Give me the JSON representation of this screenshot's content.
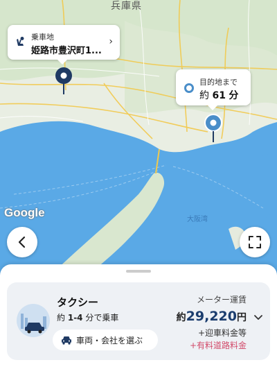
{
  "map": {
    "place_label": "兵庫県",
    "bay_label": "大阪湾",
    "provider_logo": "Google"
  },
  "pickup": {
    "title": "乗車地",
    "address": "姫路市豊沢町1...",
    "icon": "person-seat-icon"
  },
  "destination": {
    "title": "目的地まで",
    "time_prefix": "約",
    "time_value": "61",
    "time_unit": "分"
  },
  "controls": {
    "back_icon": "chevron-left-icon",
    "expand_icon": "fullscreen-icon"
  },
  "taxi": {
    "name": "タクシー",
    "eta_prefix": "約",
    "eta_value": "1-4",
    "eta_suffix": "分で乗車",
    "choose_label": "車両・会社を選ぶ"
  },
  "fare": {
    "label": "メーター運賃",
    "prefix": "約",
    "amount": "29,220",
    "unit": "円",
    "extra1": "+迎車料金等",
    "extra2": "+有料道路料金"
  },
  "colors": {
    "pin": "#1f3a63",
    "dest_pin": "#4a8ec9",
    "fare": "#1b3d6e",
    "toll": "#d24a6a",
    "sea": "#5aa9e6"
  }
}
